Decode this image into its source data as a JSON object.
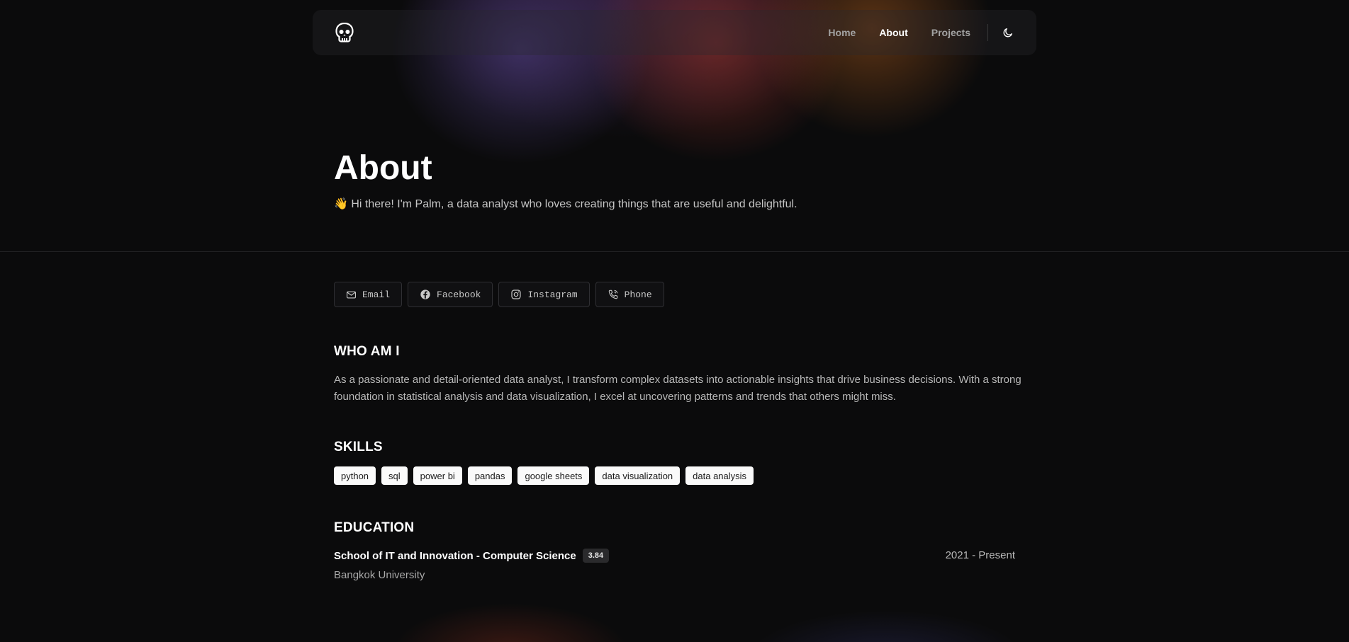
{
  "nav": {
    "logo_icon": "skull-icon",
    "links": [
      {
        "label": "Home",
        "active": false
      },
      {
        "label": "About",
        "active": true
      },
      {
        "label": "Projects",
        "active": false
      }
    ],
    "theme_icon": "moon-icon"
  },
  "hero": {
    "title": "About",
    "subtitle": "👋 Hi there! I'm Palm, a data analyst who loves creating things that are useful and delightful."
  },
  "social": [
    {
      "label": "Email",
      "icon": "mail-icon"
    },
    {
      "label": "Facebook",
      "icon": "facebook-icon"
    },
    {
      "label": "Instagram",
      "icon": "instagram-icon"
    },
    {
      "label": "Phone",
      "icon": "phone-icon"
    }
  ],
  "about": {
    "heading": "WHO AM I",
    "text": "As a passionate and detail-oriented data analyst, I transform complex datasets into actionable insights that drive business decisions. With a strong foundation in statistical analysis and data visualization, I excel at uncovering patterns and trends that others might miss."
  },
  "skills": {
    "heading": "SKILLS",
    "items": [
      "python",
      "sql",
      "power bi",
      "pandas",
      "google sheets",
      "data visualization",
      "data analysis"
    ]
  },
  "education": {
    "heading": "EDUCATION",
    "entries": [
      {
        "program": "School of IT and Innovation - Computer Science",
        "gpa": "3.84",
        "dates": "2021 - Present",
        "school": "Bangkok University"
      }
    ]
  },
  "colors": {
    "background": "#0b0b0c",
    "text": "#ffffff",
    "muted": "#b9b9b9",
    "chip_bg": "#fafafa"
  }
}
